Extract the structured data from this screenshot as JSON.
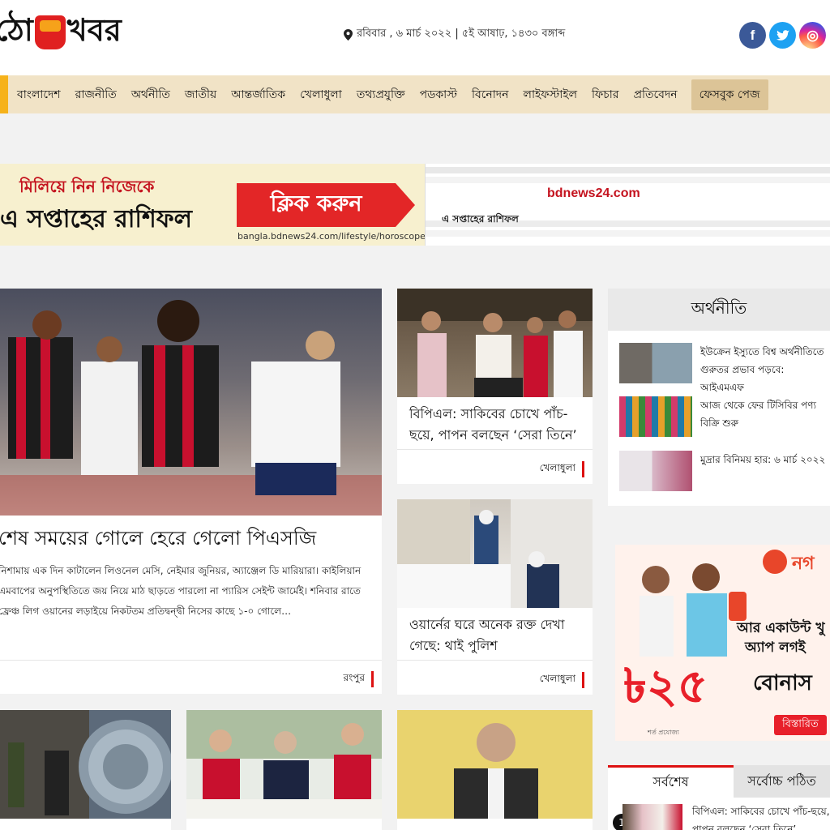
{
  "header": {
    "logo_text_left": "ঠো",
    "logo_text_right": "খবর",
    "date": "রবিবার , ৬ মার্চ ২০২২ | ৫ই আষাঢ়, ১৪৩০ বঙ্গাব্দ",
    "social": {
      "facebook": "f",
      "twitter": "t",
      "instagram": "◎"
    }
  },
  "nav": {
    "items": [
      "বাংলাদেশ",
      "রাজনীতি",
      "অর্থনীতি",
      "জাতীয়",
      "আন্তর্জাতিক",
      "খেলাধুলা",
      "তথ্যপ্রযুক্তি",
      "পডকাস্ট",
      "বিনোদন",
      "লাইফস্টাইল",
      "ফিচার",
      "প্রতিবেদন"
    ],
    "facebook_page": "ফেসবুক পেজ"
  },
  "ad_banner": {
    "line1": "মিলিয়ে নিন নিজেকে",
    "line2": "এ সপ্তাহের রাশিফল",
    "cta": "ক্লিক করুন",
    "url": "bangla.bdnews24.com/lifestyle/horoscope/",
    "shot_brand": "bdnews24.com",
    "shot_sub": "এ সপ্তাহের রাশিফল"
  },
  "lead": {
    "headline": "শেষ সময়ের গোলে হেরে গেলো পিএসজি",
    "excerpt": "নিশামায় এক দিন কাটালেন লিওনেল মেসি, নেইমার জুনিয়র, অ্যাঞ্জেল ডি মারিয়ারা। কাইলিয়ান এমবাপের অনুপস্থিতিতে জয় নিয়ে মাঠ ছাড়তে পারলো না প্যারিস সেইন্ট জার্মেই। শনিবার রাতে ফ্রেঞ্চ লিগ ওয়ানের লড়াইয়ে নিকটতম প্রতিদ্বন্দ্বী নিসের কাছে ১-০ গোলে…",
    "category": "রংপুর"
  },
  "mid_cards": [
    {
      "headline": "বিপিএল: সাকিবের চোখে পাঁচ-ছয়ে, পাপন বলছেন ‘সেরা তিনে’",
      "category": "খেলাধুলা"
    },
    {
      "headline": "ওয়ার্নের ঘরে অনেক রক্ত দেখা গেছে: থাই পুলিশ",
      "category": "খেলাধুলা"
    }
  ],
  "sidebar": {
    "title": "অর্থনীতি",
    "items": [
      {
        "text": "ইউক্রেন ইস্যুতে বিশ্ব অর্থনীতিতে গুরুতর প্রভাব পড়বে: আইএমএফ"
      },
      {
        "text": "আজ থেকে ফের টিসিবির পণ্য বিক্রি শুরু"
      },
      {
        "text": "মুদ্রার বিনিময় হার: ৬ মার্চ ২০২২"
      }
    ],
    "ad": {
      "brand": "নগ",
      "line1": "আর একাউন্ট খু",
      "line2": "অ্যাপ লগই",
      "amount": "৳২৫",
      "bonus": "বোনাস",
      "more": "বিস্তারিত",
      "foot": "শর্ত প্রযোজ্য"
    },
    "tabs": {
      "active": "সর্বশেষ",
      "other": "সর্বোচ্চ পঠিত"
    },
    "latest": [
      {
        "num": "1",
        "text": "বিপিএল: সাকিবের চোখে পাঁচ-ছয়ে, পাপন বলছেন ‘সেরা তিনে’"
      }
    ]
  },
  "colors": {
    "accent": "#d11111",
    "nav_bg": "#f1e3c6",
    "nav_edge": "#f6b21a",
    "fb_page_bg": "#dcc497"
  }
}
